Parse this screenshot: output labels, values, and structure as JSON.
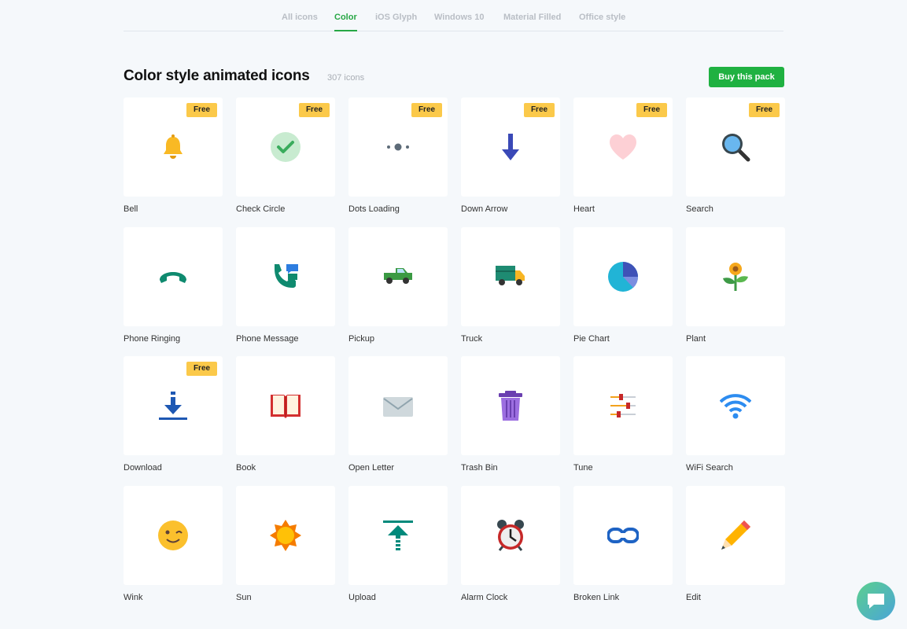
{
  "tabs": [
    "All icons",
    "Color",
    "iOS Glyph",
    "Windows 10",
    "Material Filled",
    "Office style"
  ],
  "active_tab": "Color",
  "page_title": "Color style animated icons",
  "icon_count": "307 icons",
  "buy_label": "Buy this pack",
  "free_label": "Free",
  "icons": [
    {
      "label": "Bell",
      "icon": "bell-icon",
      "free": true
    },
    {
      "label": "Check Circle",
      "icon": "check-circle-icon",
      "free": true
    },
    {
      "label": "Dots Loading",
      "icon": "dots-loading-icon",
      "free": true
    },
    {
      "label": "Down Arrow",
      "icon": "down-arrow-icon",
      "free": true
    },
    {
      "label": "Heart",
      "icon": "heart-icon",
      "free": true
    },
    {
      "label": "Search",
      "icon": "search-icon",
      "free": true
    },
    {
      "label": "Phone Ringing",
      "icon": "phone-ringing-icon",
      "free": false
    },
    {
      "label": "Phone Message",
      "icon": "phone-message-icon",
      "free": false
    },
    {
      "label": "Pickup",
      "icon": "pickup-icon",
      "free": false
    },
    {
      "label": "Truck",
      "icon": "truck-icon",
      "free": false
    },
    {
      "label": "Pie Chart",
      "icon": "pie-chart-icon",
      "free": false
    },
    {
      "label": "Plant",
      "icon": "plant-icon",
      "free": false
    },
    {
      "label": "Download",
      "icon": "download-icon",
      "free": true
    },
    {
      "label": "Book",
      "icon": "book-icon",
      "free": false
    },
    {
      "label": "Open Letter",
      "icon": "open-letter-icon",
      "free": false
    },
    {
      "label": "Trash Bin",
      "icon": "trash-bin-icon",
      "free": false
    },
    {
      "label": "Tune",
      "icon": "tune-icon",
      "free": false
    },
    {
      "label": "WiFi Search",
      "icon": "wifi-search-icon",
      "free": false
    },
    {
      "label": "Wink",
      "icon": "wink-icon",
      "free": false
    },
    {
      "label": "Sun",
      "icon": "sun-icon",
      "free": false
    },
    {
      "label": "Upload",
      "icon": "upload-icon",
      "free": false
    },
    {
      "label": "Alarm Clock",
      "icon": "alarm-clock-icon",
      "free": false
    },
    {
      "label": "Broken Link",
      "icon": "broken-link-icon",
      "free": false
    },
    {
      "label": "Edit",
      "icon": "edit-icon",
      "free": false
    }
  ],
  "colors": {
    "accent": "#27a745",
    "buy_button": "#1fb141",
    "badge": "#fbc94a"
  }
}
